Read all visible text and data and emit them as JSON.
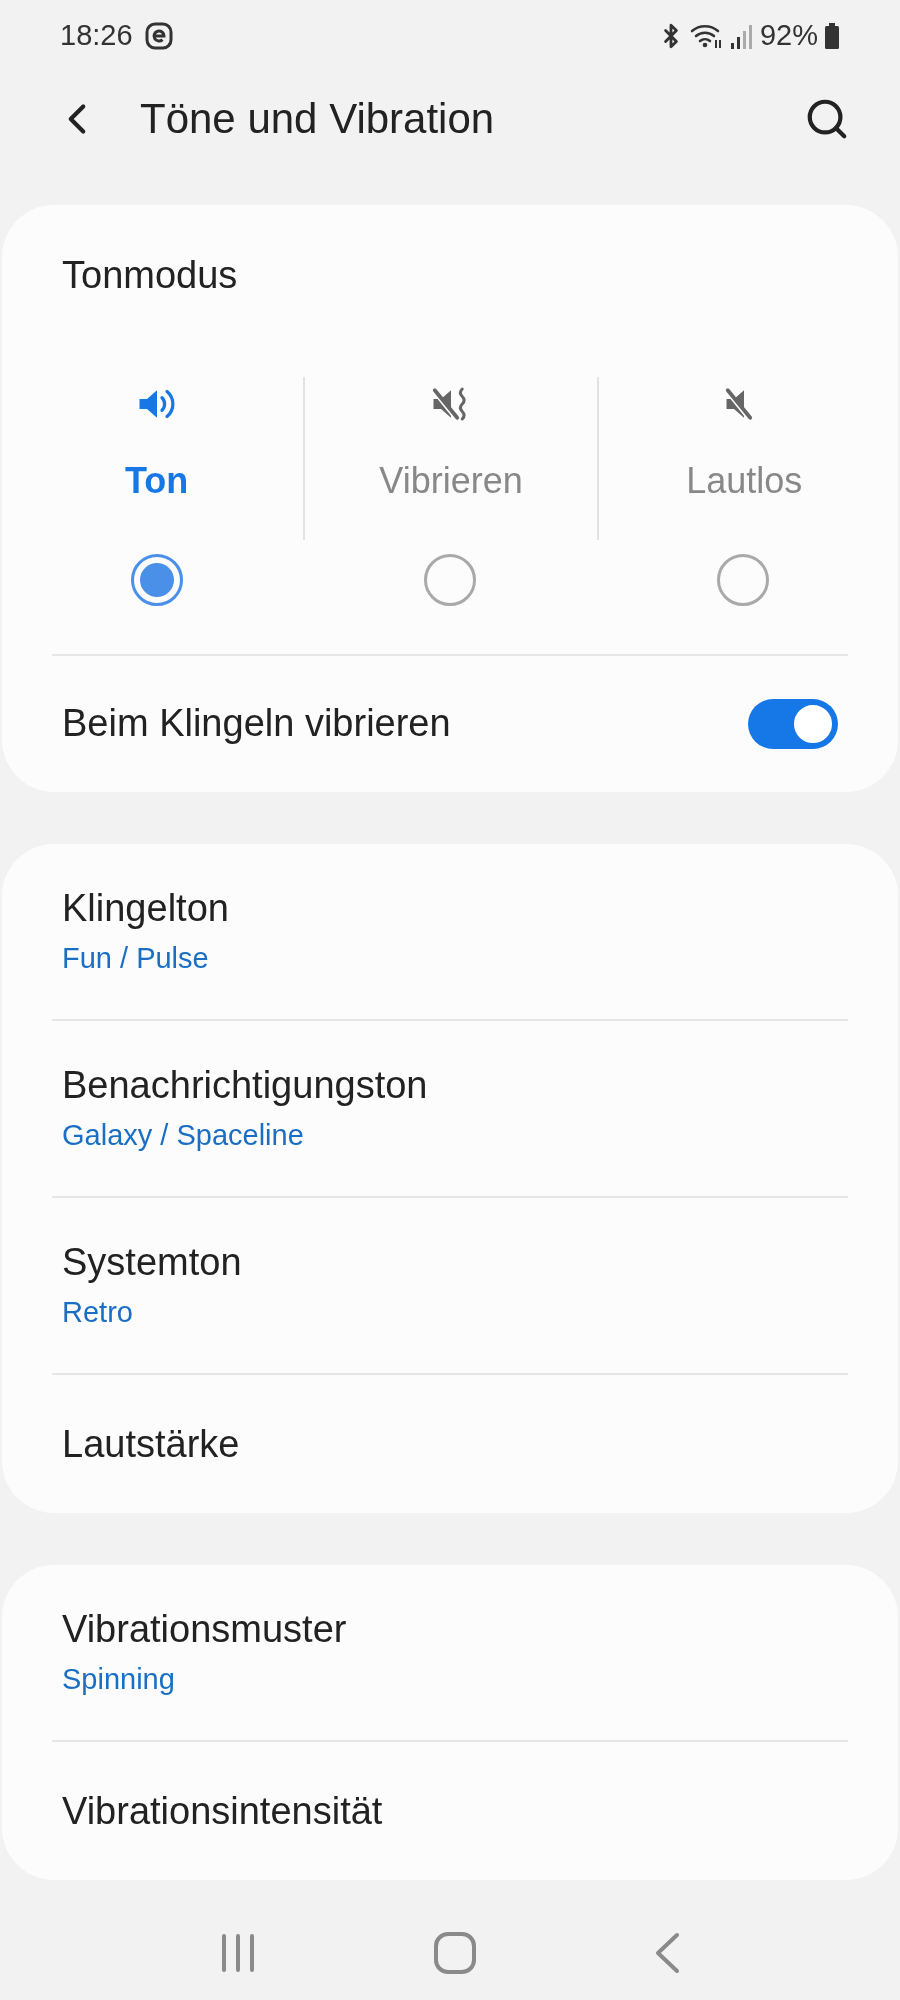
{
  "status_bar": {
    "time": "18:26",
    "battery": "92%"
  },
  "header": {
    "title": "Töne und Vibration"
  },
  "sound_mode": {
    "title": "Tonmodus",
    "options": [
      {
        "kind": "sound",
        "label": "Ton",
        "selected": true
      },
      {
        "kind": "vibrate",
        "label": "Vibrieren",
        "selected": false
      },
      {
        "kind": "mute",
        "label": "Lautlos",
        "selected": false
      }
    ]
  },
  "vibrate_when_ringing": {
    "label": "Beim Klingeln vibrieren",
    "on": true
  },
  "groups": [
    [
      {
        "title": "Klingelton",
        "subtitle": "Fun / Pulse"
      },
      {
        "title": "Benachrichtigungston",
        "subtitle": "Galaxy / Spaceline"
      },
      {
        "title": "Systemton",
        "subtitle": "Retro"
      },
      {
        "title": "Lautstärke"
      }
    ],
    [
      {
        "title": "Vibrationsmuster",
        "subtitle": "Spinning"
      },
      {
        "title": "Vibrationsintensität"
      }
    ]
  ]
}
